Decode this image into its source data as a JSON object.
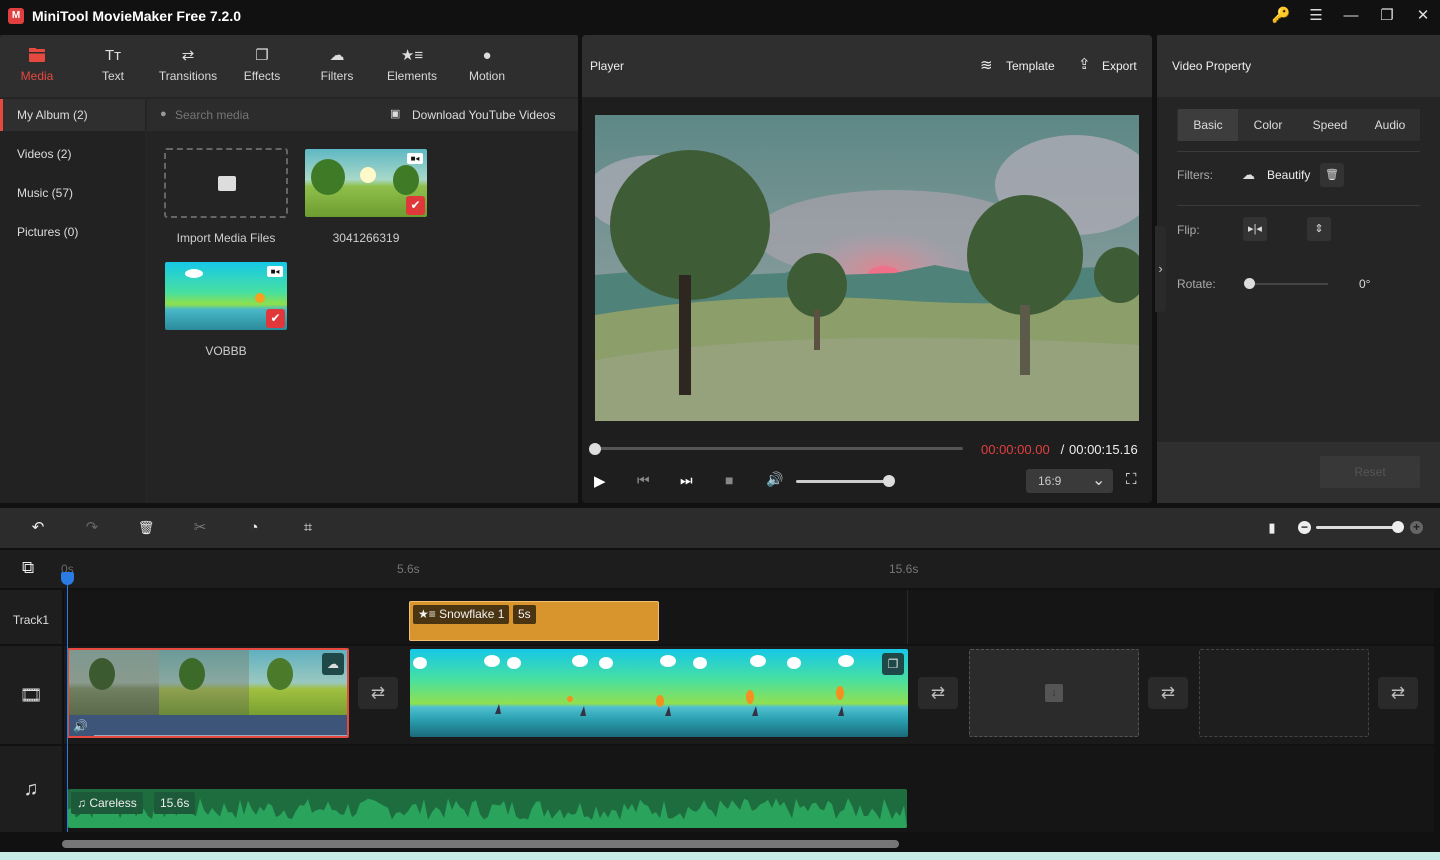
{
  "app": {
    "title": "MiniTool MovieMaker Free 7.2.0",
    "logo_glyph": "M",
    "window_controls": {
      "key": "🔑",
      "menu": "☰",
      "minimize": "—",
      "maximize": "❐",
      "close": "✕"
    }
  },
  "media_tabs": [
    {
      "label": "Media",
      "icon": "folder-icon",
      "glyph": "▬",
      "active": true
    },
    {
      "label": "Text",
      "icon": "text-icon",
      "glyph": "Tт"
    },
    {
      "label": "Transitions",
      "icon": "transitions-icon",
      "glyph": "⇄"
    },
    {
      "label": "Effects",
      "icon": "effects-icon",
      "glyph": "❐"
    },
    {
      "label": "Filters",
      "icon": "filters-icon",
      "glyph": "☁"
    },
    {
      "label": "Elements",
      "icon": "elements-icon",
      "glyph": "★≡"
    },
    {
      "label": "Motion",
      "icon": "motion-icon",
      "glyph": "●"
    }
  ],
  "album": {
    "items": [
      {
        "label": "My Album (2)",
        "active": true
      },
      {
        "label": "Videos (2)"
      },
      {
        "label": "Music (57)"
      },
      {
        "label": "Pictures (0)"
      }
    ],
    "search_placeholder": "Search media",
    "download_label": "Download YouTube Videos",
    "import_label": "Import Media Files",
    "media_items": [
      {
        "name": "3041266319",
        "type": "video",
        "selected": true
      },
      {
        "name": "VOBBB",
        "type": "video",
        "selected": true
      }
    ],
    "check_glyph": "✔"
  },
  "player": {
    "title": "Player",
    "template_label": "Template",
    "export_label": "Export",
    "current_time": "00:00:00.00",
    "separator": " / ",
    "total_time": "00:00:15.16",
    "progress": 0,
    "volume": 1.0,
    "aspect_ratio": "16:9",
    "controls": {
      "play": "▶",
      "prev": "⏮",
      "next": "⏭",
      "stop": "■",
      "volume": "🔊",
      "fullscreen": "⛶",
      "dropdown": "⌄"
    }
  },
  "property": {
    "title": "Video Property",
    "tabs": [
      {
        "label": "Basic",
        "active": true
      },
      {
        "label": "Color"
      },
      {
        "label": "Speed"
      },
      {
        "label": "Audio"
      }
    ],
    "filters_label": "Filters:",
    "filter_value": "Beautify",
    "flip_label": "Flip:",
    "rotate_label": "Rotate:",
    "rotate_value": "0°",
    "rotate_fraction": 0,
    "reset_label": "Reset",
    "collapse_glyph": "›"
  },
  "timeline": {
    "toolbar": {
      "undo": "↶",
      "redo": "↷",
      "delete": "🗑",
      "split": "✂",
      "speed": "◔",
      "crop": "⌗",
      "fit": "▮",
      "zoom_out": "−",
      "zoom_in": "+"
    },
    "zoom_level": 1.0,
    "ruler": [
      "0s",
      "5.6s",
      "15.6s"
    ],
    "tracks": {
      "track1_label": "Track1",
      "video_icon": "🎞",
      "audio_icon": "♫"
    },
    "element_clip": {
      "name": "Snowflake 1",
      "duration": "5s",
      "icon": "★≡"
    },
    "audio_clip": {
      "name": "Careless",
      "duration": "15.6s",
      "icon": "♫"
    },
    "transition_glyph": "⇄",
    "add_track_glyph": "⧉"
  }
}
